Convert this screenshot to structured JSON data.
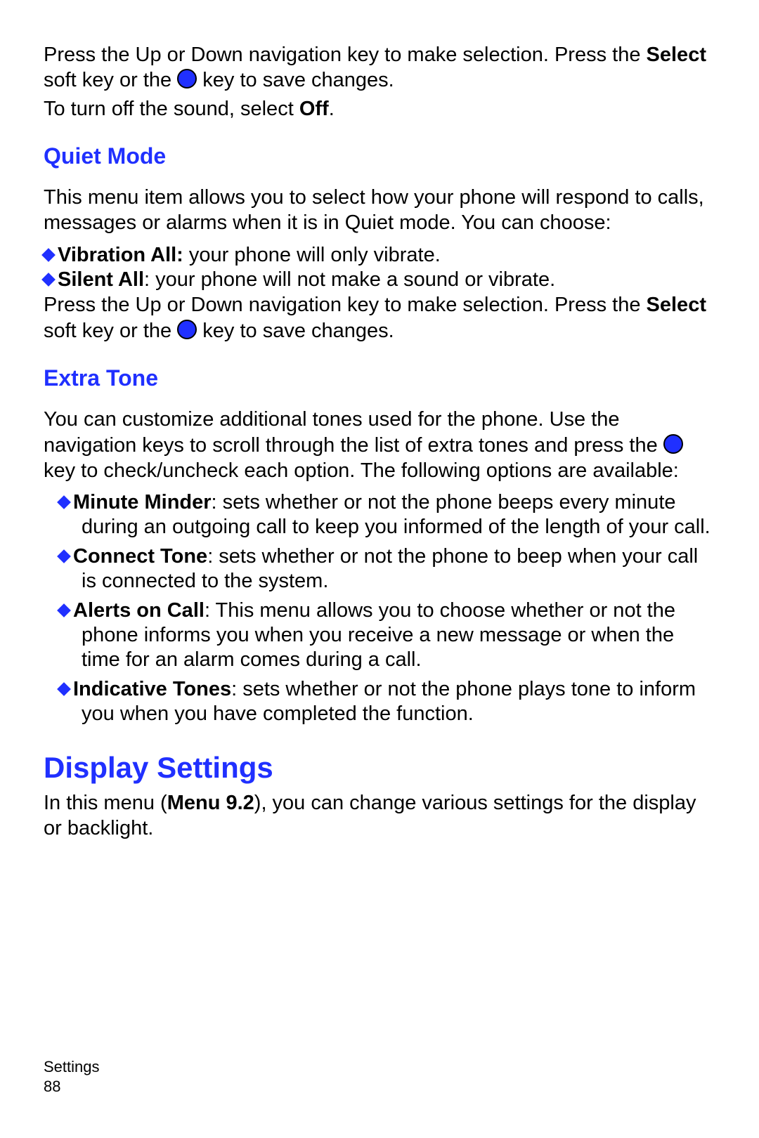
{
  "intro": {
    "p1a": "Press the Up or Down navigation key to make selection. Press the ",
    "p1b": "Select",
    "p1c": " soft key or the ",
    "p1d": " key to save changes.",
    "p2a": "To turn off the sound, select ",
    "p2b": "Off",
    "p2c": "."
  },
  "quiet": {
    "heading": "Quiet Mode",
    "p1": "This menu item allows you to select how your phone will respond to calls, messages or alarms when it is in Quiet mode. You can choose:",
    "b1a": "Vibration All:",
    "b1b": " your phone will only vibrate.",
    "b2a": "Silent All",
    "b2b": ": your phone will not make a sound or vibrate.",
    "p2a": "Press the Up or Down navigation key to make selection. Press the ",
    "p2b": "Select",
    "p2c": " soft key or the ",
    "p2d": " key to save changes."
  },
  "extra": {
    "heading": "Extra Tone",
    "p1a": "You can customize additional tones used for the phone. Use the navigation keys to scroll through the list of extra tones and press the ",
    "p1b": " key to check/uncheck each option. The following options are available:",
    "b1a": "Minute Minder",
    "b1b": ": sets whether or not the phone beeps every minute during an outgoing call to keep you informed of the length of your call.",
    "b2a": "Connect Tone",
    "b2b": ": sets whether or not the phone to beep when your call is connected to the system.",
    "b3a": "Alerts on Call",
    "b3b": ": This menu allows you to choose whether or not the phone informs you when you receive a new message or when the time for an alarm comes during a call.",
    "b4a": "Indicative Tones",
    "b4b": ": sets whether or not the phone plays tone to inform you when you have completed the function."
  },
  "display": {
    "heading": "Display Settings",
    "p1a": "In this menu (",
    "p1b": "Menu 9.2",
    "p1c": "), you can change various settings for the display or backlight."
  },
  "footer": {
    "section": "Settings",
    "page": "88"
  }
}
